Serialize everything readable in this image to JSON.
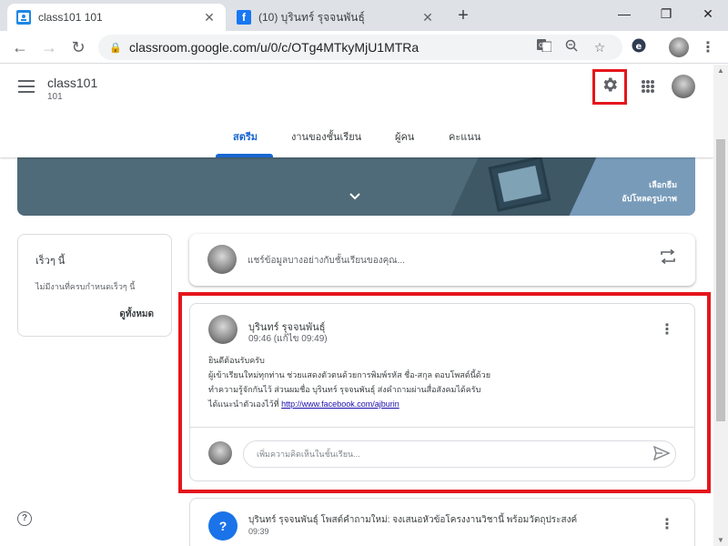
{
  "browser": {
    "tabs": [
      {
        "title": "class101 101",
        "favicon": "classroom-icon",
        "favicon_color": "#1e88e5"
      },
      {
        "title": "(10) บุรินทร์ รุจจนพันธุ์",
        "favicon": "facebook-icon",
        "favicon_color": "#1877f2"
      }
    ],
    "close_glyph": "✕",
    "new_tab_glyph": "+",
    "window_controls": {
      "minimize": "—",
      "restore": "❐",
      "close": "✕"
    },
    "url": "classroom.google.com/u/0/c/OTg4MTkyMjU1MTRa"
  },
  "header": {
    "class_name": "class101",
    "section": "101",
    "tabs": [
      {
        "label": "สตรีม",
        "active": true
      },
      {
        "label": "งานของชั้นเรียน",
        "active": false
      },
      {
        "label": "ผู้คน",
        "active": false
      },
      {
        "label": "คะแนน",
        "active": false
      }
    ]
  },
  "banner": {
    "select_theme": "เลือกธีม",
    "upload_photo": "อัปโหลดรูปภาพ"
  },
  "upcoming": {
    "title": "เร็วๆ นี้",
    "empty_text": "ไม่มีงานที่ครบกำหนดเร็วๆ นี้",
    "view_all": "ดูทั้งหมด"
  },
  "share": {
    "placeholder": "แชร์ข้อมูลบางอย่างกับชั้นเรียนของคุณ..."
  },
  "post": {
    "author": "บุรินทร์ รุจจนพันธุ์",
    "time": "09:46 (แก้ไข 09:49)",
    "lines": [
      "ยินดีต้อนรับครับ",
      "ผู้เข้าเรียนใหม่ทุกท่าน ช่วยแสดงตัวตนด้วยการพิมพ์รหัส ชื่อ-สกุล ตอบโพสต์นี้ด้วย",
      "ทำความรู้จักกันไว้ ส่วนผมชื่อ บุรินทร์ รุจจนพันธุ์ ส่งคำถามผ่านสื่อสังคมได้ครับ"
    ],
    "last_line_prefix": "ได้แนะนำตัวเองไว้ที่ ",
    "link": "http://www.facebook.com/ajburin",
    "comment_placeholder": "เพิ่มความคิดเห็นในชั้นเรียน..."
  },
  "post2": {
    "title": "บุรินทร์ รุจจนพันธุ์ โพสต์คำถามใหม่: จงเสนอหัวข้อโครงงานวิชานี้ พร้อมวัตถุประสงค์",
    "time": "09:39"
  },
  "colors": {
    "accent": "#1967d2",
    "highlight": "#e4161c",
    "banner": "#4f6a78"
  }
}
